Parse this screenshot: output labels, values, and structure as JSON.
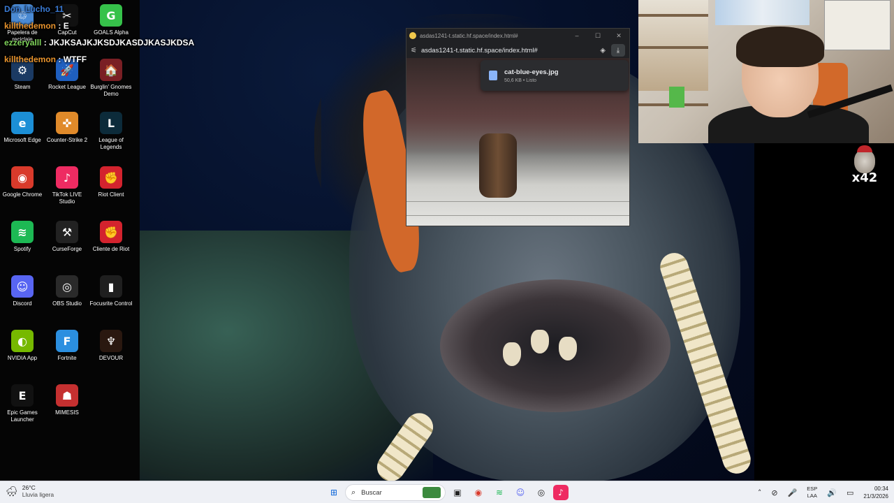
{
  "chat": [
    {
      "user": "Don_Lucho_11",
      "message": "",
      "color": "#3a7bd5"
    },
    {
      "user": "killthedemon",
      "message": "E",
      "color": "#e8932c"
    },
    {
      "user": "ezzeryalll",
      "message": "JKJKSAJKJKSDJKASDJKASJKDSA",
      "color": "#7fd35a"
    },
    {
      "user": "killthedemon",
      "message": "WTFF",
      "color": "#e8932c"
    }
  ],
  "chat_sep": ":",
  "desktop_icons": [
    {
      "label": "Papelera de reciclaje",
      "icon": "recycle-bin-icon",
      "glyph": "♲",
      "color": "#4a8ad4"
    },
    {
      "label": "CapCut",
      "icon": "capcut-icon",
      "glyph": "✂",
      "color": "#111111"
    },
    {
      "label": "GOALS Alpha",
      "icon": "goals-icon",
      "glyph": "G",
      "color": "#36c24a"
    },
    {
      "label": "Steam",
      "icon": "steam-icon",
      "glyph": "⚙",
      "color": "#1b3a63"
    },
    {
      "label": "Rocket League",
      "icon": "rocket-league-icon",
      "glyph": "🚀",
      "color": "#1f5fbf"
    },
    {
      "label": "Burglin' Gnomes Demo",
      "icon": "burglin-gnomes-icon",
      "glyph": "🏠",
      "color": "#7a1f24"
    },
    {
      "label": "Microsoft Edge",
      "icon": "edge-icon",
      "glyph": "e",
      "color": "#1c8fd6"
    },
    {
      "label": "Counter-Strike 2",
      "icon": "counter-strike-icon",
      "glyph": "✜",
      "color": "#e08a2a"
    },
    {
      "label": "League of Legends",
      "icon": "league-icon",
      "glyph": "L",
      "color": "#0c2b3a"
    },
    {
      "label": "Google Chrome",
      "icon": "chrome-icon",
      "glyph": "◉",
      "color": "#d93a2b"
    },
    {
      "label": "TikTok LIVE Studio",
      "icon": "tiktok-live-icon",
      "glyph": "♪",
      "color": "#ee2b62"
    },
    {
      "label": "Riot Client",
      "icon": "riot-client-icon",
      "glyph": "✊",
      "color": "#d3232e"
    },
    {
      "label": "Spotify",
      "icon": "spotify-icon",
      "glyph": "≋",
      "color": "#1db954"
    },
    {
      "label": "CurseForge",
      "icon": "curseforge-icon",
      "glyph": "⚒",
      "color": "#222222"
    },
    {
      "label": "Cliente de Riot",
      "icon": "riot-client-2-icon",
      "glyph": "✊",
      "color": "#d3232e"
    },
    {
      "label": "Discord",
      "icon": "discord-icon",
      "glyph": "☺",
      "color": "#5865f2"
    },
    {
      "label": "OBS Studio",
      "icon": "obs-icon",
      "glyph": "◎",
      "color": "#2a2a2a"
    },
    {
      "label": "Focusrite Control",
      "icon": "focusrite-icon",
      "glyph": "▮",
      "color": "#1f1f1f"
    },
    {
      "label": "NVIDIA App",
      "icon": "nvidia-icon",
      "glyph": "◐",
      "color": "#76b900"
    },
    {
      "label": "Fortnite",
      "icon": "fortnite-icon",
      "glyph": "F",
      "color": "#2b8fe0"
    },
    {
      "label": "DEVOUR",
      "icon": "devour-icon",
      "glyph": "♆",
      "color": "#2a1810"
    },
    {
      "label": "Epic Games Launcher",
      "icon": "epic-games-icon",
      "glyph": "E",
      "color": "#111111"
    },
    {
      "label": "MIMESIS",
      "icon": "mimesis-icon",
      "glyph": "☗",
      "color": "#c53030"
    }
  ],
  "browser": {
    "title": "asdas1241-t.static.hf.space/index.html#",
    "url": "asdas1241-t.static.hf.space/index.html#",
    "minimize": "–",
    "maximize": "☐",
    "close": "✕",
    "download": {
      "filename": "cat-blue-eyes.jpg",
      "meta": "50,6 KB • Listo"
    }
  },
  "badge": {
    "count": "x42"
  },
  "taskbar": {
    "weather_temp": "26°C",
    "weather_cond": "Lluvia ligera",
    "search_placeholder": "Buscar",
    "lang_top": "ESP",
    "lang_bottom": "LAA",
    "time": "00:34",
    "date": "21/3/2026"
  }
}
